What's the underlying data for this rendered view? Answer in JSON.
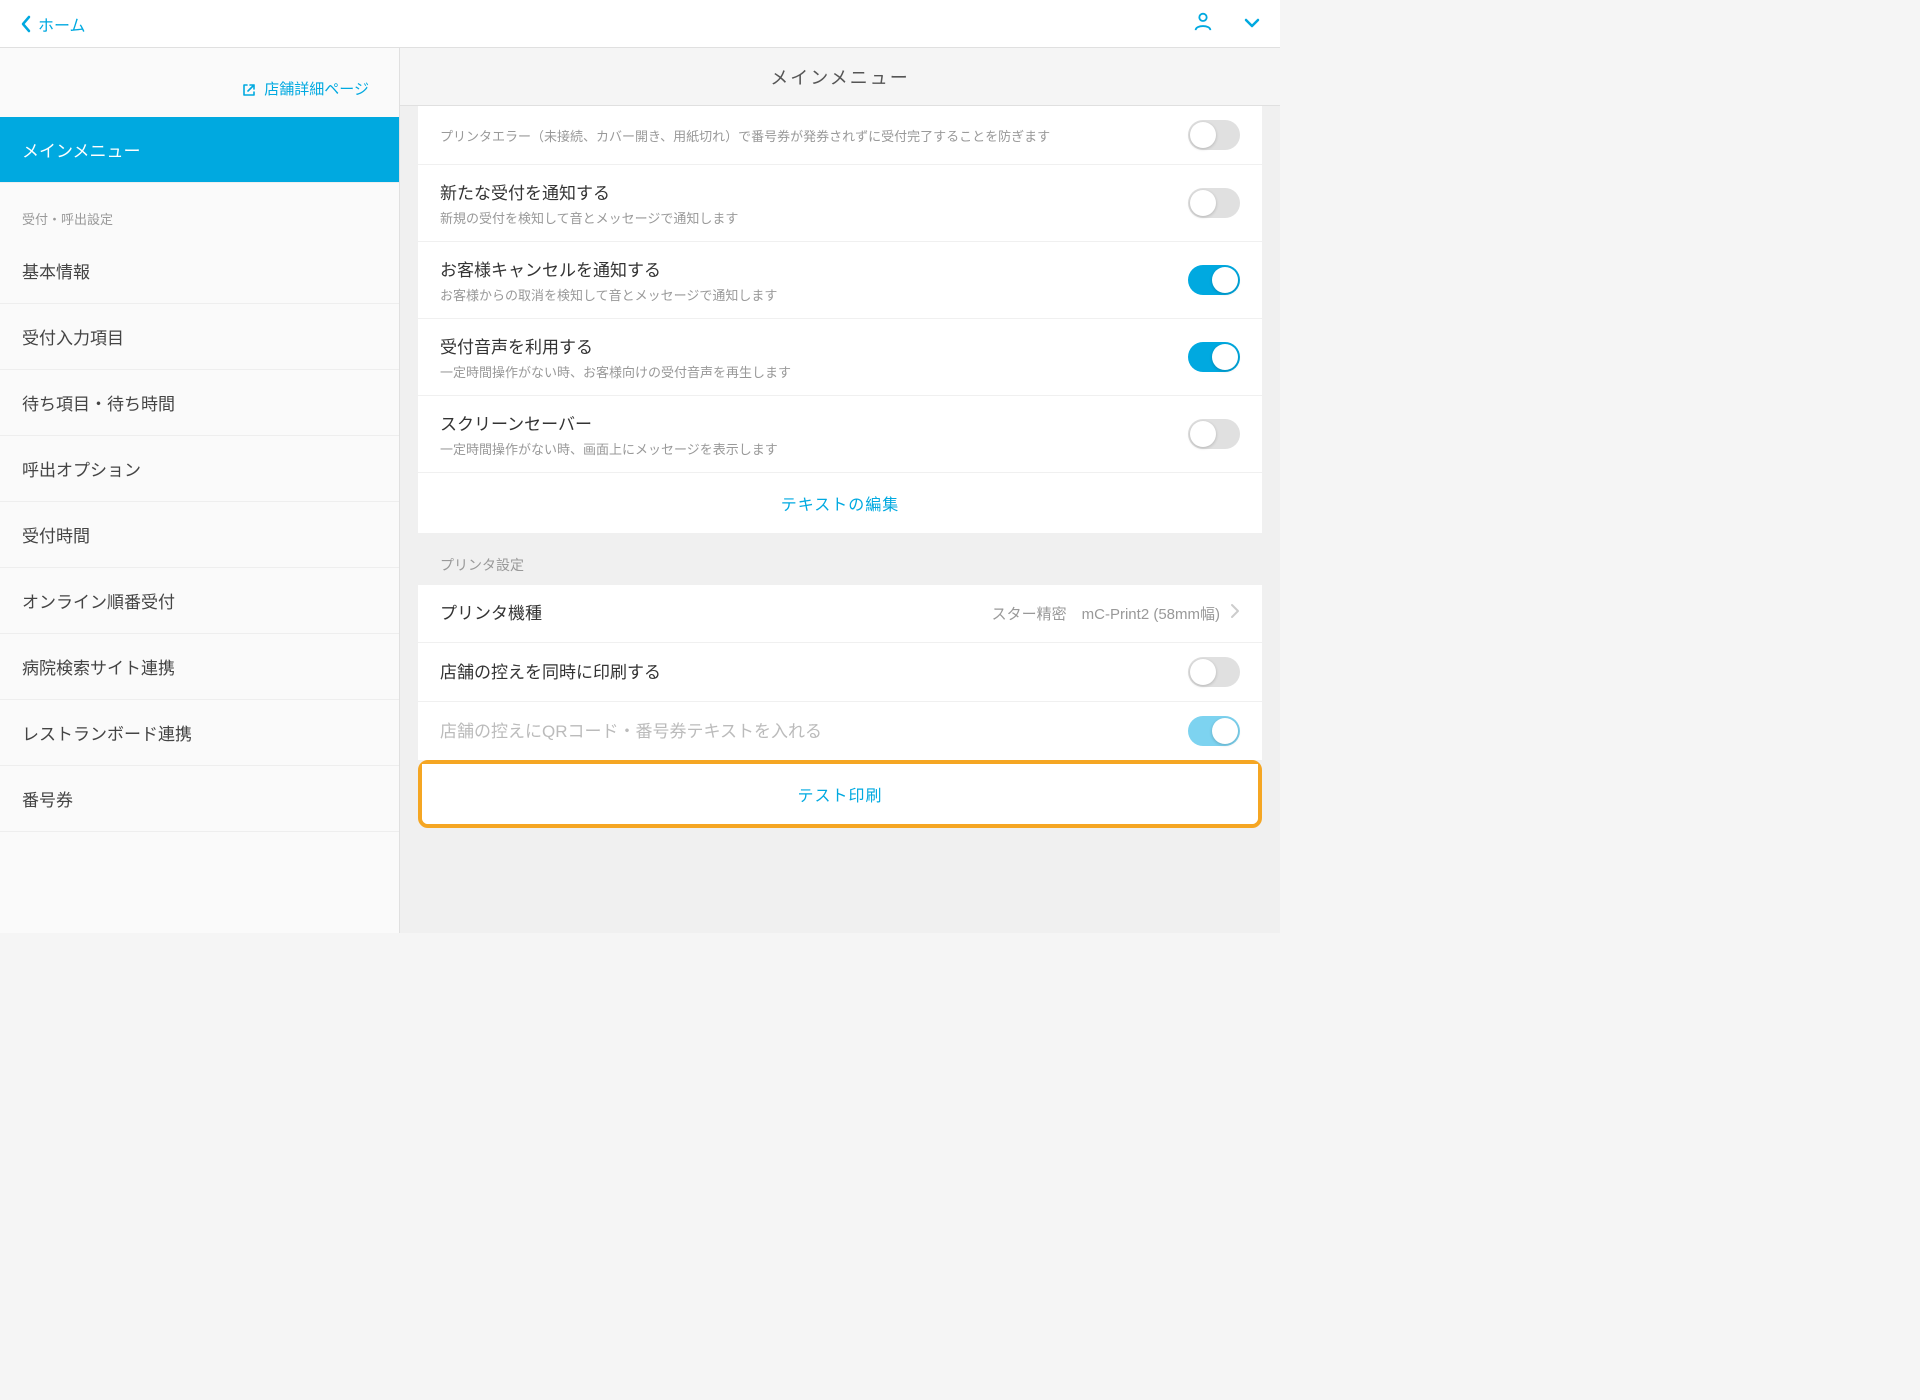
{
  "topbar": {
    "back_label": "ホーム"
  },
  "sidebar": {
    "store_detail_link": "店舗詳細ページ",
    "main_menu_label": "メインメニュー",
    "section_header": "受付・呼出設定",
    "items": [
      "基本情報",
      "受付入力項目",
      "待ち項目・待ち時間",
      "呼出オプション",
      "受付時間",
      "オンライン順番受付",
      "病院検索サイト連携",
      "レストランボード連携",
      "番号券"
    ]
  },
  "main": {
    "title": "メインメニュー",
    "settings_a": [
      {
        "title": "",
        "subtitle": "プリンタエラー（未接続、カバー開き、用紙切れ）で番号券が発券されずに受付完了することを防ぎます",
        "on": false
      },
      {
        "title": "新たな受付を通知する",
        "subtitle": "新規の受付を検知して音とメッセージで通知します",
        "on": false
      },
      {
        "title": "お客様キャンセルを通知する",
        "subtitle": "お客様からの取消を検知して音とメッセージで通知します",
        "on": true
      },
      {
        "title": "受付音声を利用する",
        "subtitle": "一定時間操作がない時、お客様向けの受付音声を再生します",
        "on": true
      },
      {
        "title": "スクリーンセーバー",
        "subtitle": "一定時間操作がない時、画面上にメッセージを表示します",
        "on": false
      }
    ],
    "text_edit_link": "テキストの編集",
    "printer_section_label": "プリンタ設定",
    "printer_model_label": "プリンタ機種",
    "printer_model_value": "スター精密　mC-Print2 (58mm幅)",
    "printer_rows": [
      {
        "title": "店舗の控えを同時に印刷する",
        "on": false,
        "disabled": false
      },
      {
        "title": "店舗の控えにQRコード・番号券テキストを入れる",
        "on": true,
        "disabled": true
      }
    ],
    "test_print_label": "テスト印刷"
  }
}
